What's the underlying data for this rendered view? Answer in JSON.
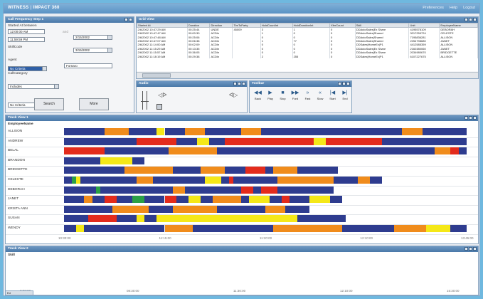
{
  "colors": {
    "blue": "#2e3c8f",
    "orange": "#f08c1c",
    "red": "#e32b1c",
    "yellow": "#f5e818",
    "green": "#2aa046"
  },
  "header": {
    "logo_left": "WITNESS",
    "logo_sep": "|",
    "logo_right": "IMPACT 360",
    "links": [
      "Preferences",
      "Help",
      "Logout"
    ]
  },
  "filter_pane": {
    "title": "Call Frequency Step 1",
    "started_between_label": "Started At between",
    "start_time": "12:00:00 AM",
    "start_date": "2/15/2002",
    "end_time": "11:59:59 PM",
    "end_date": "3/15/2002",
    "and_label": "and",
    "skill_label": "SkillCode",
    "skill_value": "No Criteria",
    "agent_label": "Agent",
    "agent_op": "Includes",
    "agent_value": "Fornaro",
    "category_label": "CallCategory",
    "category_value": "No Criteria",
    "search_label": "Search",
    "more_label": "More"
  },
  "grid": {
    "title": "Grid View",
    "columns": [
      "Started At",
      "Duration",
      "Direction",
      "TimToParty",
      "HoldCountInt",
      "HoldDurationInt",
      "XferCount",
      "Skill",
      "Unit",
      "EmployeeName"
    ],
    "rows": [
      [
        "2/6/2002 10:47:29 AM",
        "00:25:44",
        "UNDE",
        "45009",
        "3",
        "1",
        "0",
        "DDAutoSales|Ex Share",
        "4195578109",
        "DEBORAH"
      ],
      [
        "2/6/2002 10:47:47 AM",
        "00:00:30",
        "ACDIn",
        "",
        "1",
        "0",
        "0",
        "DDAutoSales|Shared",
        "3217259724",
        "CELESTE"
      ],
      [
        "2/6/2002 10:47:48 AM",
        "00:25:06",
        "ACDIn",
        "",
        "0",
        "0",
        "0",
        "DDAutoSales|Shared",
        "7195836281",
        "ALLISON"
      ],
      [
        "2/6/2002 10:47:07 AM",
        "00:06:38",
        "ACDIn",
        "",
        "1",
        "77",
        "0",
        "DDAutoSales|Shared",
        "2254798680",
        "JANET"
      ],
      [
        "2/6/2002 11:14:00 AM",
        "00:02:09",
        "ACDIn",
        "",
        "0",
        "0",
        "0",
        "DDSales|HomeEx|P1",
        "4412585359",
        "ALLISON"
      ],
      [
        "2/6/2002 11:15:29 AM",
        "00:13:35",
        "ACDIn",
        "",
        "0",
        "0",
        "0",
        "DDAutoSales|Ex Share",
        "2160380060",
        "JANET"
      ],
      [
        "2/6/2002 11:15:57 AM",
        "00:36:05",
        "ACDIn",
        "",
        "0",
        "0",
        "0",
        "DDAutoSales|Ex Share",
        "2034980670",
        "BRIDGETTE"
      ],
      [
        "2/6/2002 11:18:19 AM",
        "00:29:38",
        "ACDIn",
        "",
        "2",
        "255",
        "0",
        "DDSales|HomeEx|P1",
        "6107227675",
        "ALLISON"
      ]
    ]
  },
  "audio": {
    "title": "Audio"
  },
  "toolbar": {
    "title": "Toolbar",
    "buttons": [
      "Back",
      "Play",
      "Stop",
      "Ford",
      "Fast",
      "Slow",
      "Start",
      "End"
    ],
    "glyphs": [
      "◀◀",
      "▶",
      "■",
      "▶▶",
      "»",
      "«",
      "|◀",
      "▶|"
    ]
  },
  "track_view": {
    "title": "Track View 1",
    "header": "EmployeeName",
    "employees": [
      "ALLISON",
      "ANDREW",
      "BELAL",
      "BRANDON",
      "BRIDGETTE",
      "CELESTE",
      "DEBORAH",
      "JANET",
      "KRISTA ANN",
      "SUSAN",
      "WENDY"
    ],
    "time_labels": [
      "10:30:00",
      "11:15:00",
      "11:20:00",
      "12:10:00",
      "13:45:00"
    ],
    "tracks": [
      [
        [
          "b",
          0,
          0.1
        ],
        [
          "o",
          0.1,
          0.06
        ],
        [
          "b",
          0.16,
          0.07
        ],
        [
          "y",
          0.23,
          0.02
        ],
        [
          "b",
          0.25,
          0.05
        ],
        [
          "o",
          0.3,
          0.05
        ],
        [
          "b",
          0.35,
          0.09
        ],
        [
          "o",
          0.44,
          0.05
        ],
        [
          "b",
          0.49,
          0.35
        ],
        [
          "o",
          0.84,
          0.05
        ],
        [
          "b",
          0.89,
          0.11
        ]
      ],
      [
        [
          "b",
          0,
          0.18
        ],
        [
          "r",
          0.18,
          0.1
        ],
        [
          "b",
          0.28,
          0.05
        ],
        [
          "y",
          0.33,
          0.03
        ],
        [
          "b",
          0.36,
          0.04
        ],
        [
          "r",
          0.4,
          0.22
        ],
        [
          "y",
          0.62,
          0.03
        ],
        [
          "r",
          0.65,
          0.14
        ],
        [
          "b",
          0.79,
          0.21
        ]
      ],
      [
        [
          "r",
          0,
          0.1
        ],
        [
          "b",
          0.1,
          0.16
        ],
        [
          "o",
          0.26,
          0.12
        ],
        [
          "b",
          0.38,
          0.07
        ],
        [
          "b",
          0.45,
          0.47
        ],
        [
          "o",
          0.92,
          0.04
        ],
        [
          "r",
          0.96,
          0.02
        ],
        [
          "b",
          0.98,
          0.02
        ]
      ],
      [
        [
          "b",
          0,
          0.09
        ],
        [
          "y",
          0.09,
          0.08
        ],
        [
          "b",
          0.17,
          0.03
        ]
      ],
      [
        [
          "b",
          0,
          0.15
        ],
        [
          "o",
          0.15,
          0.12
        ],
        [
          "b",
          0.27,
          0.07
        ],
        [
          "o",
          0.34,
          0.06
        ],
        [
          "b",
          0.4,
          0.05
        ],
        [
          "r",
          0.45,
          0.05
        ],
        [
          "b",
          0.5,
          0.02
        ],
        [
          "o",
          0.52,
          0.06
        ],
        [
          "b",
          0.58,
          0.1
        ]
      ],
      [
        [
          "b",
          0,
          0.02
        ],
        [
          "g",
          0.02,
          0.01
        ],
        [
          "y",
          0.03,
          0.01
        ],
        [
          "b",
          0.04,
          0.14
        ],
        [
          "o",
          0.18,
          0.04
        ],
        [
          "b",
          0.22,
          0.13
        ],
        [
          "y",
          0.35,
          0.04
        ],
        [
          "b",
          0.39,
          0.02
        ],
        [
          "r",
          0.41,
          0.01
        ],
        [
          "b",
          0.42,
          0.11
        ],
        [
          "o",
          0.53,
          0.14
        ],
        [
          "b",
          0.67,
          0.06
        ],
        [
          "o",
          0.73,
          0.03
        ],
        [
          "b",
          0.76,
          0.03
        ]
      ],
      [
        [
          "b",
          0,
          0.08
        ],
        [
          "g",
          0.08,
          0.01
        ],
        [
          "b",
          0.09,
          0.18
        ],
        [
          "o",
          0.27,
          0.03
        ],
        [
          "b",
          0.3,
          0.14
        ],
        [
          "r",
          0.44,
          0.03
        ],
        [
          "b",
          0.47,
          0.02
        ],
        [
          "r",
          0.49,
          0.04
        ],
        [
          "b",
          0.53,
          0.14
        ]
      ],
      [
        [
          "b",
          0,
          0.05
        ],
        [
          "o",
          0.05,
          0.02
        ],
        [
          "b",
          0.07,
          0.03
        ],
        [
          "r",
          0.1,
          0.03
        ],
        [
          "b",
          0.13,
          0.04
        ],
        [
          "g",
          0.17,
          0.03
        ],
        [
          "b",
          0.2,
          0.05
        ],
        [
          "r",
          0.25,
          0.03
        ],
        [
          "b",
          0.28,
          0.03
        ],
        [
          "y",
          0.31,
          0.03
        ],
        [
          "b",
          0.34,
          0.03
        ],
        [
          "o",
          0.37,
          0.07
        ],
        [
          "b",
          0.44,
          0.02
        ],
        [
          "y",
          0.46,
          0.05
        ],
        [
          "b",
          0.51,
          0.03
        ],
        [
          "r",
          0.54,
          0.02
        ],
        [
          "b",
          0.56,
          0.05
        ],
        [
          "y",
          0.61,
          0.05
        ],
        [
          "b",
          0.66,
          0.03
        ]
      ],
      [
        [
          "b",
          0,
          0.12
        ],
        [
          "o",
          0.12,
          0.09
        ],
        [
          "b",
          0.21,
          0.06
        ],
        [
          "o",
          0.27,
          0.11
        ],
        [
          "b",
          0.38,
          0.12
        ],
        [
          "o",
          0.5,
          0.05
        ],
        [
          "b",
          0.55,
          0.06
        ]
      ],
      [
        [
          "b",
          0,
          0.06
        ],
        [
          "r",
          0.06,
          0.07
        ],
        [
          "b",
          0.13,
          0.05
        ],
        [
          "y",
          0.18,
          0.02
        ],
        [
          "b",
          0.2,
          0.03
        ],
        [
          "y",
          0.23,
          0.35
        ],
        [
          "b",
          0.58,
          0.12
        ]
      ],
      [
        [
          "b",
          0,
          0.03
        ],
        [
          "y",
          0.03,
          0.02
        ],
        [
          "b",
          0.05,
          0.2
        ],
        [
          "o",
          0.25,
          0.07
        ],
        [
          "b",
          0.32,
          0.2
        ],
        [
          "o",
          0.52,
          0.17
        ],
        [
          "b",
          0.69,
          0.13
        ],
        [
          "o",
          0.82,
          0.08
        ],
        [
          "y",
          0.9,
          0.06
        ],
        [
          "b",
          0.96,
          0.04
        ]
      ]
    ]
  },
  "track_view2": {
    "title": "Track View 2",
    "header": "Skill",
    "time_labels": [
      "0:30:00",
      "08:30:00",
      "11:30:00",
      "12:10:00",
      "15:30:00"
    ],
    "corner_label": "Ed"
  }
}
